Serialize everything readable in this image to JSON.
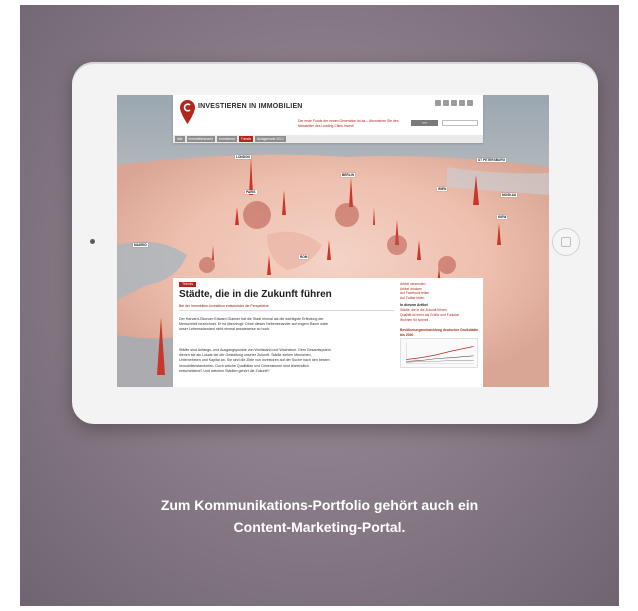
{
  "site": {
    "logo_text": "INVESTIEREN IN IMMOBILIEN",
    "promo_text": "Der erste Fonds der neuen Generation ist da – Abonnieren Sie den Newsletter des Leading Cities Invest!",
    "promo_button": "›››››",
    "nav_tabs": [
      {
        "label": "Alle"
      },
      {
        "label": "Immobilienmarkt"
      },
      {
        "label": "Investment"
      },
      {
        "label": "Trends"
      },
      {
        "label": "Anlagemarkt 2012"
      }
    ]
  },
  "map": {
    "cities": [
      "LONDON",
      "PARIS",
      "BERLIN",
      "WIEN",
      "MOSKAU",
      "KIEW",
      "MADRID",
      "ROM",
      "ST PETERSBURG"
    ]
  },
  "article": {
    "category": "Trends",
    "headline": "Städte, die in die Zukunft führen",
    "subline": "Bei der Immobilien-Investition entscheidet die Perspektive",
    "paragraph_1": "Der Harvard-Ökonom Edward Glaeser hat die Stadt einmal als die wichtigste Erfindung der Menschheit bezeichnet. Er ist überzeugt: Ohne dieses Nebeneinander auf engem Raum wäre unser Lebensstandard nicht einmal ansatzweise so hoch.",
    "paragraph_2": "Städte sind Anfangs- und Ausgangspunkte von Wohlstand und Wachstum. Dem Gesamtsystem dienen sie als Lokale bei der Gestaltung unserer Zukunft. Städte ziehen Menschen, Unternehmen und Kapital an. Sie sind die Ziele von Investoren auf der Suche nach den besten Immobilienstandorten. Doch welche Qualitäten und Dimensionen sind letztendlich entscheidend? Und welchen Städten gehört die Zukunft?"
  },
  "sidebar": {
    "actions": [
      "Artikel versenden",
      "Artikel drucken",
      "Auf Facebook teilen",
      "Auf Twitter teilen"
    ],
    "heading": "In diesem Artikel",
    "links": [
      "Städte, die in die Zukunft führen",
      "Qualität ist mehr als Größe und Funktion",
      "Wohnen für schnell"
    ],
    "chart_title": "Bevölkerungsentwicklung deutscher Großstädte bis 2030"
  },
  "caption": {
    "line_1": "Zum Kommunikations-Portfolio gehört auch ein",
    "line_2": "Content-Marketing-Portal."
  },
  "colors": {
    "accent": "#b3261d",
    "panel": "#8a7d89",
    "device": "#f3f3f4"
  }
}
